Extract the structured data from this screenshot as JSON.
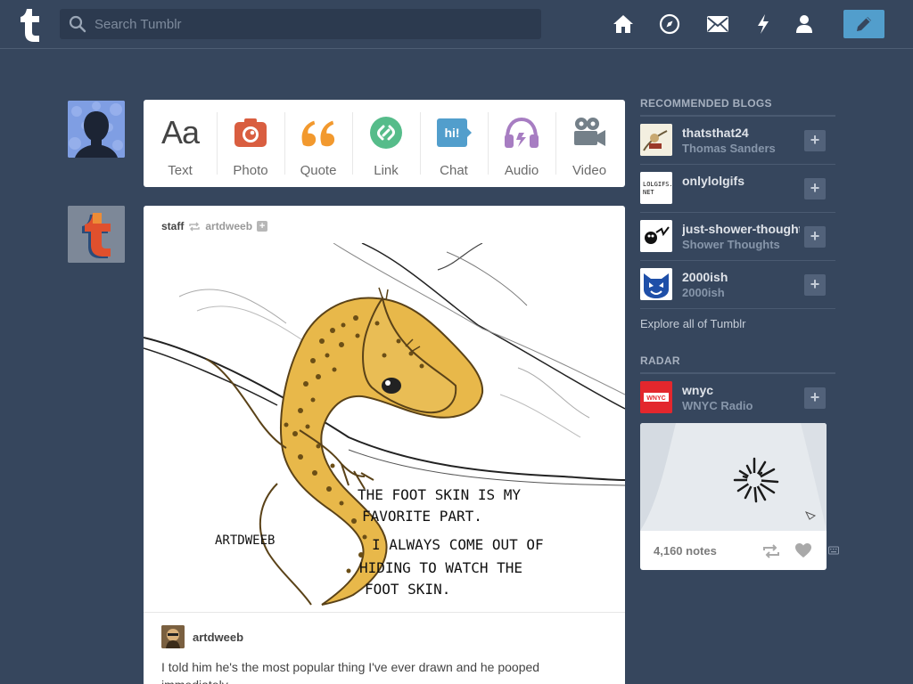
{
  "header": {
    "search_placeholder": "Search Tumblr",
    "nav_icons": [
      "home-icon",
      "explore-compass-icon",
      "inbox-mail-icon",
      "activity-lightning-icon",
      "account-person-icon"
    ],
    "compose_icon": "pencil-icon"
  },
  "post_types": [
    {
      "label": "Text",
      "icon": "text-aa-icon",
      "color": "#444444"
    },
    {
      "label": "Photo",
      "icon": "camera-icon",
      "color": "#d95e40"
    },
    {
      "label": "Quote",
      "icon": "quote-icon",
      "color": "#f2992e"
    },
    {
      "label": "Link",
      "icon": "link-icon",
      "color": "#56bc8a"
    },
    {
      "label": "Chat",
      "icon": "chat-bubble-icon",
      "color": "#529ecc"
    },
    {
      "label": "Audio",
      "icon": "headphones-icon",
      "color": "#a77dc2"
    },
    {
      "label": "Video",
      "icon": "video-camera-icon",
      "color": "#748089"
    }
  ],
  "post": {
    "user": "staff",
    "reblogged_from": "artdweeb",
    "art_text": {
      "line1": "THE FOOT SKIN IS MY",
      "line2": "FAVORITE PART.",
      "line3": "I ALWAYS COME OUT OF",
      "line4": "HIDING TO WATCH THE",
      "line5": "FOOT SKIN.",
      "signature": "ARTDWEEB"
    },
    "author": "artdweeb",
    "caption": "I told him he's the most popular thing I've ever drawn and he pooped immediately."
  },
  "sidebar": {
    "recommended_title": "RECOMMENDED BLOGS",
    "blogs": [
      {
        "name": "thatsthat24",
        "sub": "Thomas Sanders"
      },
      {
        "name": "onlylolgifs",
        "sub": ""
      },
      {
        "name": "just-shower-thoughts",
        "sub": "Shower Thoughts"
      },
      {
        "name": "2000ish",
        "sub": "2000ish"
      }
    ],
    "lolgifs_logo_text": "LOLGIFS.\nNET",
    "explore_link": "Explore all of Tumblr",
    "radar_title": "RADAR",
    "radar_blog": {
      "name": "wnyc",
      "sub": "WNYC Radio",
      "logo_text": "WNYC"
    },
    "radar_notes": "4,160 notes"
  },
  "colors": {
    "background": "#36465d",
    "compose": "#529ecc"
  }
}
